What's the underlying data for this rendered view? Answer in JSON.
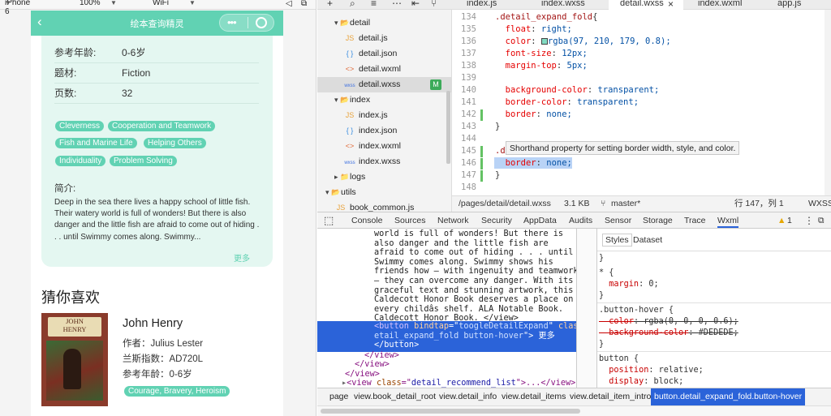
{
  "simulator": {
    "device": "iPhone 6",
    "zoom": "100%",
    "network": "WiFi"
  },
  "phone": {
    "nav_title": "绘本查询精灵",
    "info": [
      {
        "label": "参考年龄:",
        "value": "0-6岁"
      },
      {
        "label": "题材:",
        "value": "Fiction"
      },
      {
        "label": "页数:",
        "value": "32"
      }
    ],
    "tags": [
      "Cleverness",
      "Cooperation and Teamwork",
      "Fish and Marine Life",
      "Helping Others",
      "Individuality",
      "Problem Solving"
    ],
    "summary_label": "简介:",
    "summary_text": "Deep in the sea there lives a happy school of little fish. Their watery world is full of wonders! But there is also danger and the little fish are afraid to come out of hiding . . . until Swimmy comes along. Swimmy...",
    "more": "更多",
    "recommend_title": "猜你喜欢",
    "recommend": {
      "cover_text_1": "JOHN",
      "cover_text_2": "HENRY",
      "title": "John Henry",
      "author_label": "作者：",
      "author": "Julius Lester",
      "lexile_label": "兰斯指数：",
      "lexile": "AD720L",
      "age_label": "参考年龄：",
      "age": "0-6岁",
      "tag": "Courage, Bravery, Heroism"
    }
  },
  "file_tree": [
    {
      "name": "detail",
      "icon": "folder-open",
      "indent": 1
    },
    {
      "name": "detail.js",
      "icon": "js",
      "indent": 2
    },
    {
      "name": "detail.json",
      "icon": "json",
      "indent": 2
    },
    {
      "name": "detail.wxml",
      "icon": "wxml",
      "indent": 2
    },
    {
      "name": "detail.wxss",
      "icon": "wxss",
      "indent": 2,
      "selected": true,
      "badge": "M"
    },
    {
      "name": "index",
      "icon": "folder-open",
      "indent": 1
    },
    {
      "name": "index.js",
      "icon": "js",
      "indent": 2
    },
    {
      "name": "index.json",
      "icon": "json",
      "indent": 2
    },
    {
      "name": "index.wxml",
      "icon": "wxml",
      "indent": 2
    },
    {
      "name": "index.wxss",
      "icon": "wxss",
      "indent": 2
    },
    {
      "name": "logs",
      "icon": "folder",
      "indent": 1
    },
    {
      "name": "utils",
      "icon": "folder-open",
      "indent": 0
    },
    {
      "name": "book_common.js",
      "icon": "js",
      "indent": 1
    }
  ],
  "editor_tabs": [
    "index.js",
    "index.wxss",
    "detail.wxss",
    "index.wxml",
    "app.js"
  ],
  "code_lines": [
    {
      "n": "134",
      "t": ".detail_expand_fold{"
    },
    {
      "n": "135",
      "t": "  float: right;"
    },
    {
      "n": "136",
      "t": "  color: rgba(97, 210, 179, 0.8);"
    },
    {
      "n": "137",
      "t": "  font-size: 12px;"
    },
    {
      "n": "138",
      "t": "  margin-top: 5px;"
    },
    {
      "n": "139",
      "t": ""
    },
    {
      "n": "140",
      "t": "  background-color: transparent;"
    },
    {
      "n": "141",
      "t": "  border-color: transparent;"
    },
    {
      "n": "142",
      "t": "  border: none;"
    },
    {
      "n": "143",
      "t": "}"
    },
    {
      "n": "144",
      "t": ""
    },
    {
      "n": "145",
      "t": ".d"
    },
    {
      "n": "146",
      "t": "  border: none;"
    },
    {
      "n": "147",
      "t": "}"
    },
    {
      "n": "148",
      "t": ""
    }
  ],
  "tooltip": "Shorthand property for setting border width, style, and color.",
  "status": {
    "path": "/pages/detail/detail.wxss",
    "size": "3.1 KB",
    "branch": "master*",
    "position": "行 147，列 1",
    "lang": "WXSS"
  },
  "devtools_tabs": [
    "Console",
    "Sources",
    "Network",
    "Security",
    "AppData",
    "Audits",
    "Sensor",
    "Storage",
    "Trace",
    "Wxml"
  ],
  "warning_count": "1",
  "wxml_lines": [
    "world is full of wonders! But there is",
    "also danger and the little fish are",
    "afraid to come out of hiding . . . until",
    "Swimmy comes along. Swimmy shows his",
    "friends how – with ingenuity and teamwork",
    "– they can overcome any danger. With its",
    "graceful text and stunning artwork, this",
    "Caldecott Honor Book deserves a place on",
    "every childâs shelf. ALA Notable Book.",
    "Caldecott Honor Book. </view>"
  ],
  "wxml_selected": {
    "line1a": "<button ",
    "line1b": "bindtap",
    "line1c": "=\"",
    "line1d": "toogleDetailExpand",
    "line1e": "\" ",
    "line1f": "class",
    "line2a": "etail_expand_fold button-hover",
    "line2b": "\"> 更多",
    "line3": "</button>"
  },
  "wxml_after": [
    "</view>",
    "</view>",
    "</view>"
  ],
  "wxml_recommend": {
    "open": "<view ",
    "attr": "class",
    "eq": "=\"",
    "val": "detail_recommend_list",
    "close": "\">...</view>"
  },
  "styles_tabs": [
    "Styles",
    "Dataset"
  ],
  "styles_rules": [
    {
      "t": "}"
    },
    {
      "t": "* {"
    },
    {
      "t": "  margin",
      "v": ": 0;"
    },
    {
      "t": "}"
    },
    {
      "t": ".button-hover {"
    },
    {
      "t": "  color",
      "v": ": rgba(0, 0, 0, 0.6);",
      "strike": true
    },
    {
      "t": "  background-color",
      "v": ": #DEDEDE;",
      "strike": true
    },
    {
      "t": "}"
    },
    {
      "t": "button {"
    },
    {
      "t": "  position",
      "v": ": relative;"
    },
    {
      "t": "  display",
      "v": ": block;"
    }
  ],
  "breadcrumbs": [
    "page",
    "view.book_detail_root",
    "view.detail_info",
    "view.detail_items",
    "view.detail_item_intro",
    "button.detail_expand_fold.button-hover"
  ],
  "colors": {
    "accent": "#61d2b3",
    "selection": "#2b63d9"
  }
}
